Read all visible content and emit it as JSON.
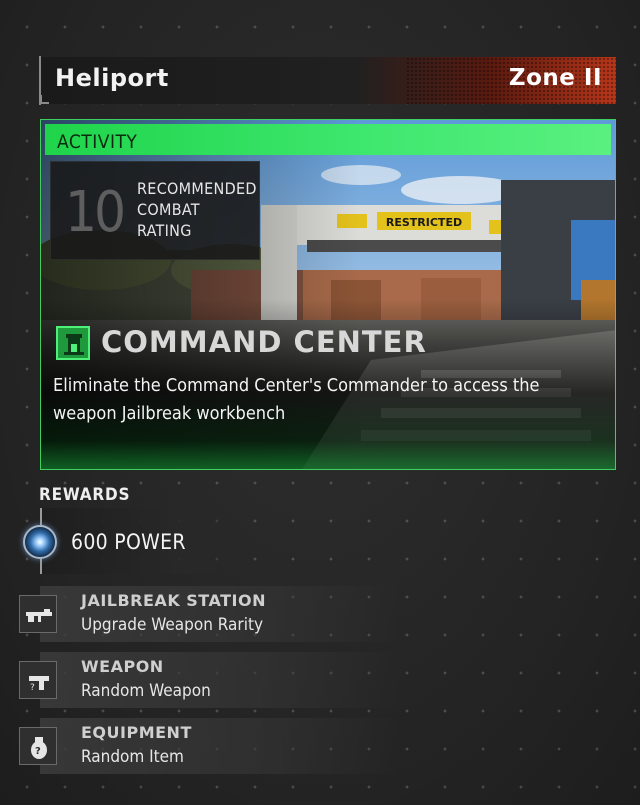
{
  "header": {
    "title": "Heliport",
    "zone": "Zone II",
    "accent_color": "#b8361a"
  },
  "activity": {
    "label": "ACTIVITY",
    "accent_color": "#3ecf5f",
    "recommended_rating": "10",
    "rating_caption": "RECOMMENDED\nCOMBAT\nRATING",
    "sign_text": "RESTRICTED",
    "location_icon": "command-center-icon",
    "title": "COMMAND CENTER",
    "description": "Eliminate the Command Center's Commander to access the weapon Jailbreak workbench"
  },
  "rewards": {
    "heading": "REWARDS",
    "power": {
      "icon": "power-orb-icon",
      "label": "600 POWER"
    },
    "items": [
      {
        "icon": "rifle-icon",
        "title": "JAILBREAK STATION",
        "subtitle": "Upgrade Weapon Rarity"
      },
      {
        "icon": "pistol-icon",
        "title": "WEAPON",
        "subtitle": "Random Weapon"
      },
      {
        "icon": "grenade-icon",
        "title": "EQUIPMENT",
        "subtitle": "Random Item"
      }
    ]
  }
}
